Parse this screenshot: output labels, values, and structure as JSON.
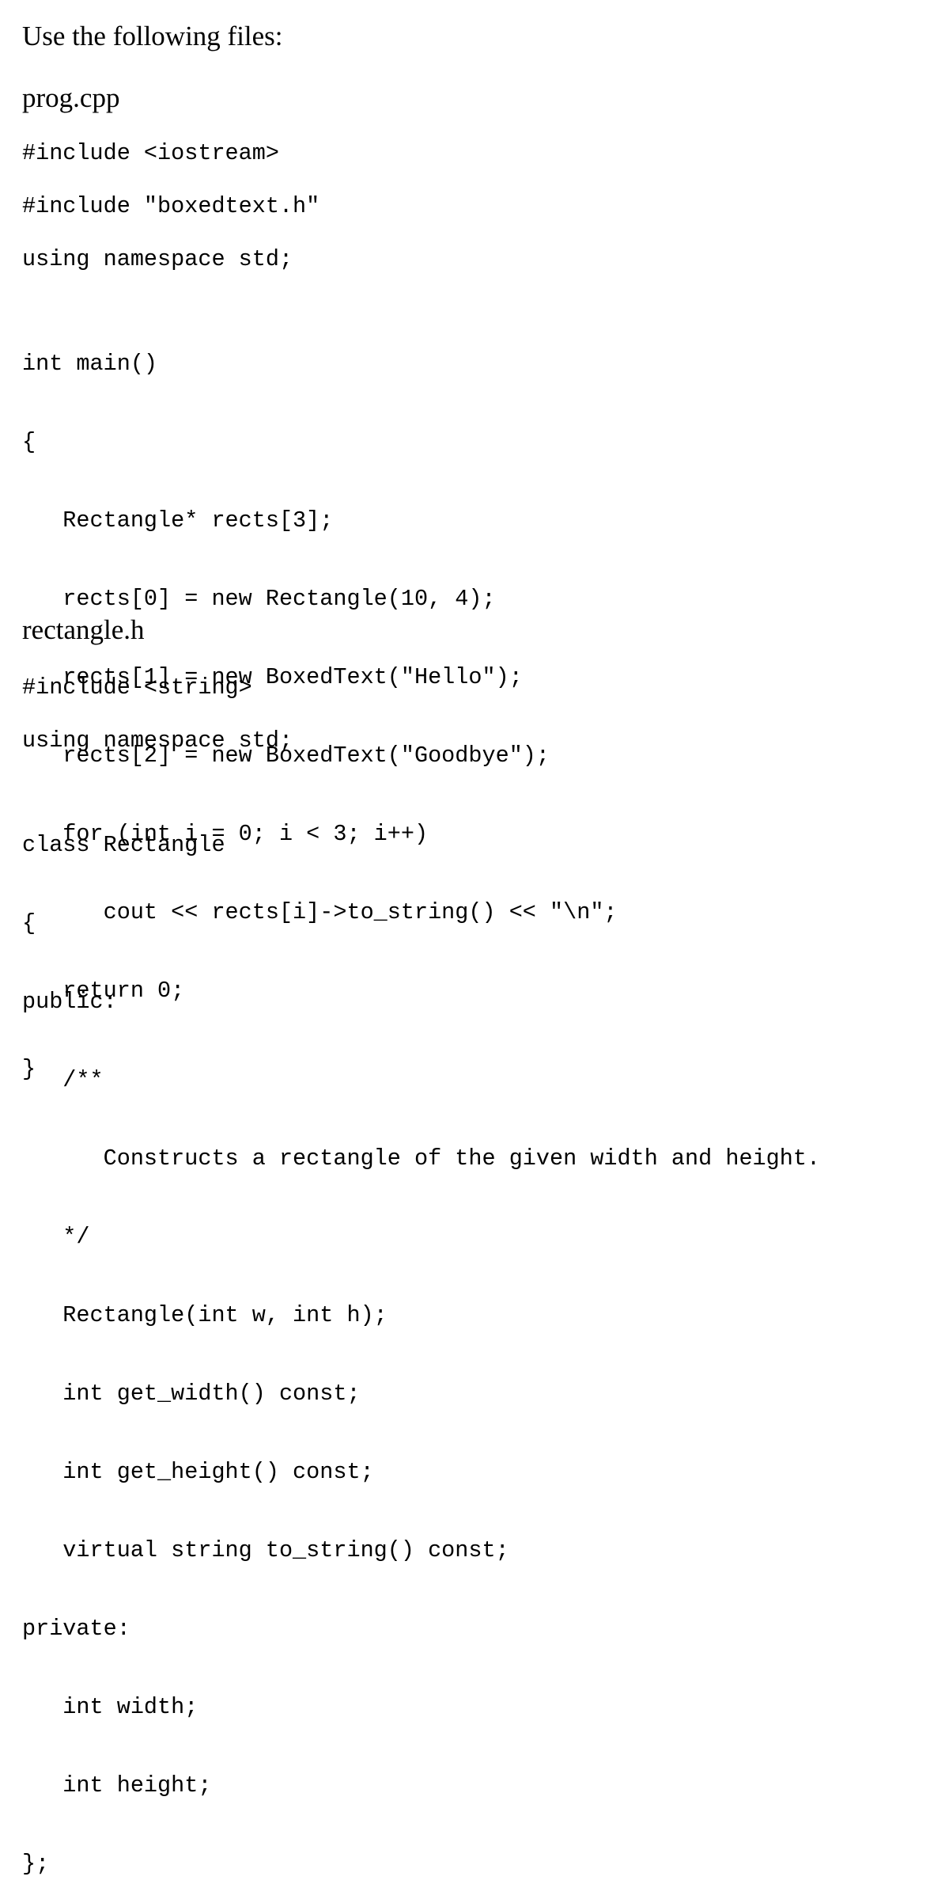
{
  "intro": "Use the following files:",
  "files": [
    {
      "name": "prog.cpp",
      "blocks": [
        [
          "#include <iostream>"
        ],
        [
          "#include \"boxedtext.h\""
        ],
        [
          "using namespace std;"
        ],
        [
          "int main()",
          "{",
          "   Rectangle* rects[3];",
          "   rects[0] = new Rectangle(10, 4);",
          "   rects[1] = new BoxedText(\"Hello\");",
          "   rects[2] = new BoxedText(\"Goodbye\");",
          "   for (int i = 0; i < 3; i++)",
          "      cout << rects[i]->to_string() << \"\\n\";",
          "   return 0;",
          "}"
        ]
      ]
    },
    {
      "name": "rectangle.h",
      "blocks": [
        [
          "#include <string>"
        ],
        [
          "using namespace std;"
        ],
        [
          "class Rectangle",
          "{",
          "public:",
          "   /**",
          "      Constructs a rectangle of the given width and height.",
          "   */",
          "   Rectangle(int w, int h);",
          "   int get_width() const;",
          "   int get_height() const;",
          "   virtual string to_string() const;",
          "private:",
          "   int width;",
          "   int height;",
          "};"
        ]
      ]
    }
  ]
}
